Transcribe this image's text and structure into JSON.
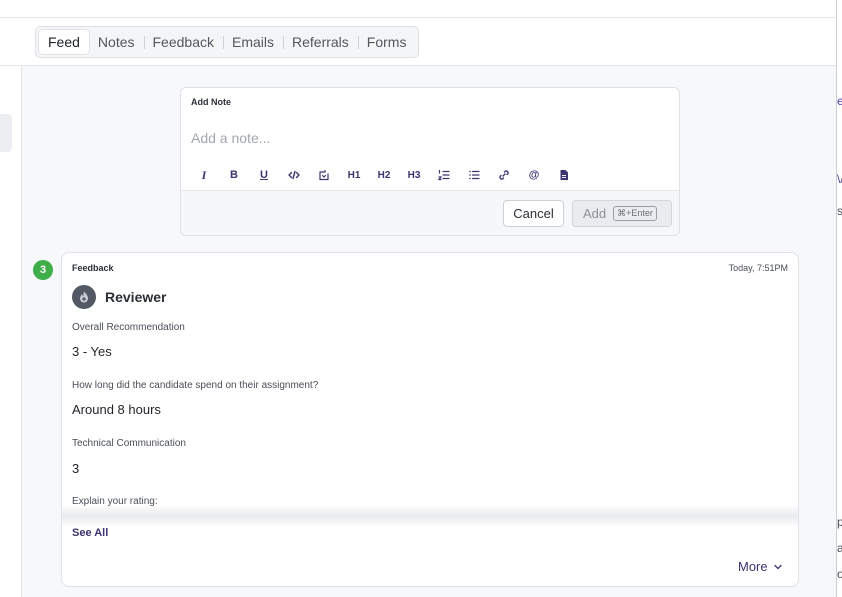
{
  "tabs": [
    {
      "label": "Feed",
      "active": true
    },
    {
      "label": "Notes",
      "active": false
    },
    {
      "label": "Feedback",
      "active": false
    },
    {
      "label": "Emails",
      "active": false
    },
    {
      "label": "Referrals",
      "active": false
    },
    {
      "label": "Forms",
      "active": false
    }
  ],
  "note": {
    "title": "Add Note",
    "placeholder": "Add a note...",
    "toolbar": [
      {
        "name": "italic",
        "label": "I"
      },
      {
        "name": "bold",
        "label": "B"
      },
      {
        "name": "underline",
        "label": "U"
      },
      {
        "name": "code",
        "label": ""
      },
      {
        "name": "code-block",
        "label": ""
      },
      {
        "name": "heading-1",
        "label": "H1"
      },
      {
        "name": "heading-2",
        "label": "H2"
      },
      {
        "name": "heading-3",
        "label": "H3"
      },
      {
        "name": "ordered-list",
        "label": ""
      },
      {
        "name": "bullet-list",
        "label": ""
      },
      {
        "name": "link",
        "label": ""
      },
      {
        "name": "mention",
        "label": "@"
      },
      {
        "name": "attachment",
        "label": ""
      }
    ],
    "cancel_label": "Cancel",
    "add_label": "Add",
    "shortcut": "⌘+Enter"
  },
  "feedback": {
    "badge": "3",
    "type": "Feedback",
    "timestamp": "Today, 7:51PM",
    "reviewer": "Reviewer",
    "items": [
      {
        "question": "Overall Recommendation",
        "answer": "3 - Yes"
      },
      {
        "question": "How long did the candidate spend on their assignment?",
        "answer": "Around 8 hours"
      },
      {
        "question": "Technical Communication",
        "answer": "3"
      },
      {
        "question": "Explain your rating:",
        "answer": ""
      }
    ],
    "see_all": "See All",
    "more": "More"
  },
  "right_panel": {
    "fragments": [
      "er",
      "\\/",
      "s",
      "p",
      "a",
      "o"
    ]
  },
  "colors": {
    "accent": "#3c3570",
    "badge": "#3fae49",
    "background": "#f7f8fa"
  }
}
